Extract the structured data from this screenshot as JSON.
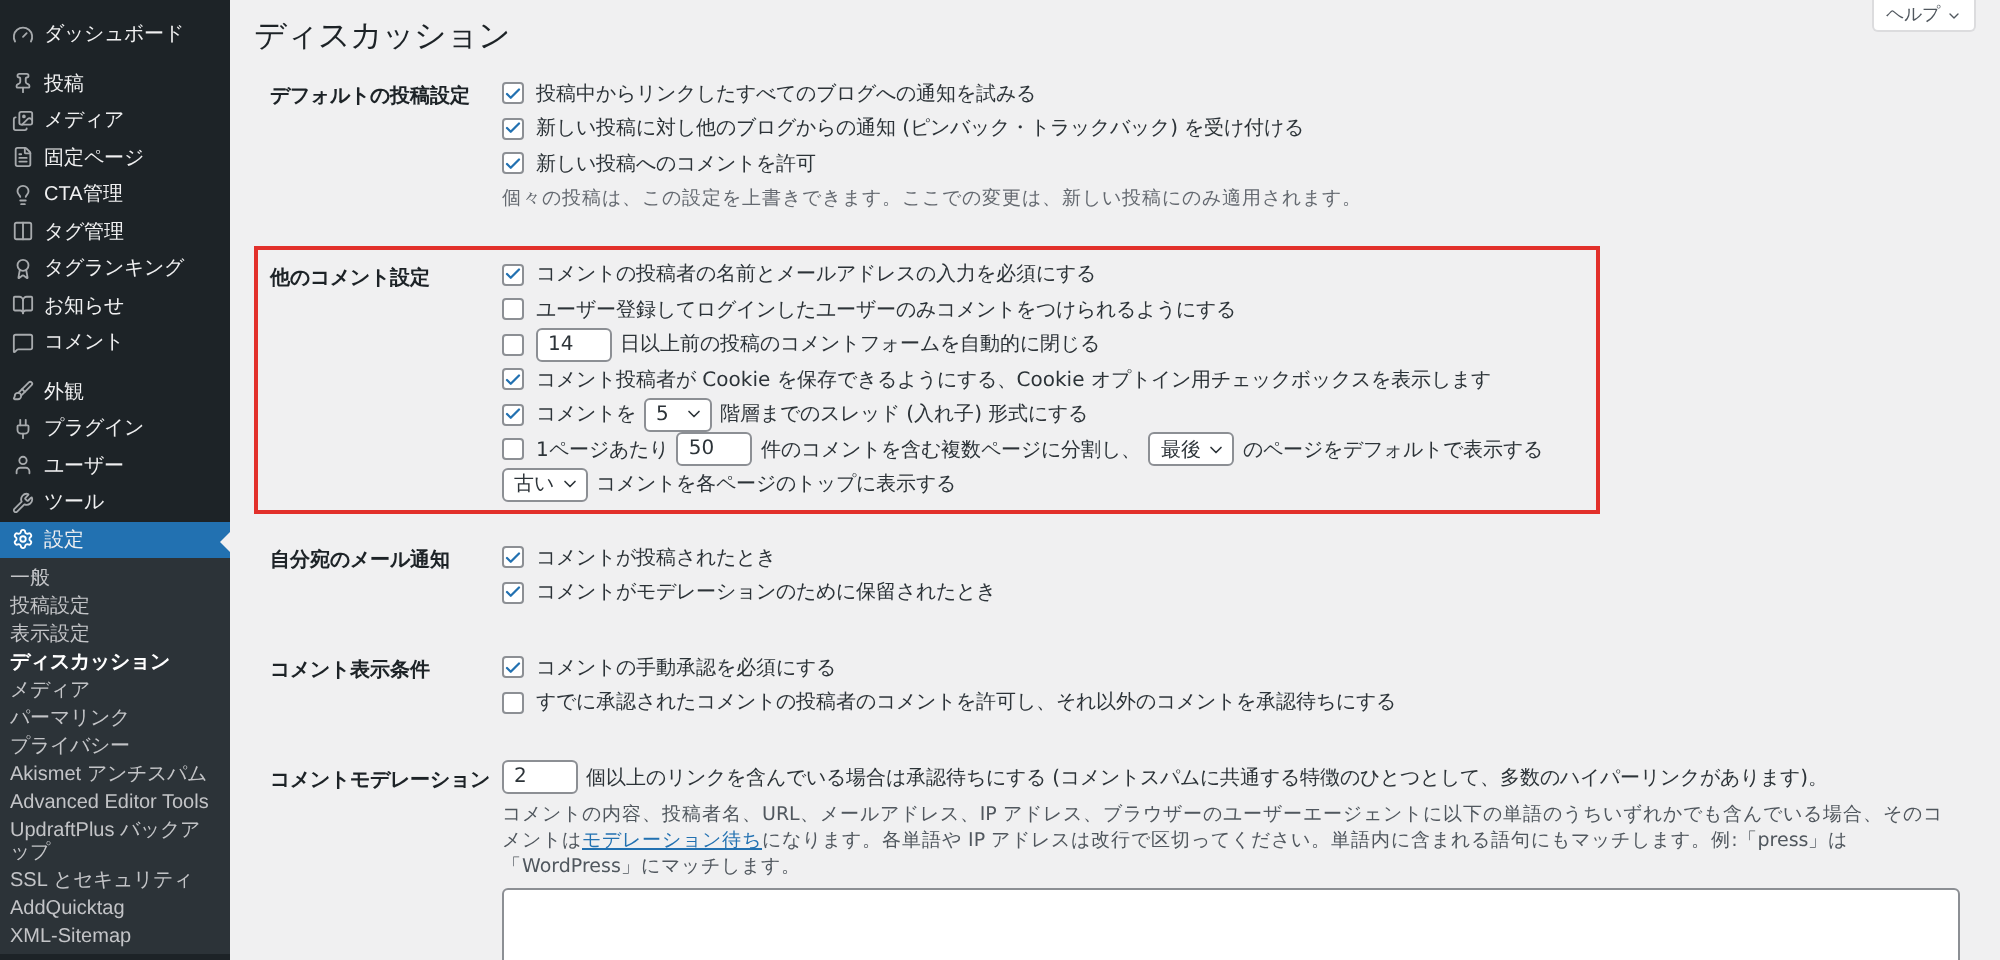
{
  "sidebar": {
    "groups": [
      [
        {
          "label": "ダッシュボード",
          "current": false
        }
      ],
      [
        {
          "label": "投稿",
          "current": false
        },
        {
          "label": "メディア",
          "current": false
        },
        {
          "label": "固定ページ",
          "current": false
        },
        {
          "label": "CTA管理",
          "current": false
        },
        {
          "label": "タグ管理",
          "current": false
        },
        {
          "label": "タグランキング",
          "current": false
        },
        {
          "label": "お知らせ",
          "current": false
        },
        {
          "label": "コメント",
          "current": false
        }
      ],
      [
        {
          "label": "外観",
          "current": false
        },
        {
          "label": "プラグイン",
          "current": false
        },
        {
          "label": "ユーザー",
          "current": false
        },
        {
          "label": "ツール",
          "current": false
        },
        {
          "label": "設定",
          "current": true,
          "submenu": [
            {
              "label": "一般",
              "selected": false
            },
            {
              "label": "投稿設定",
              "selected": false
            },
            {
              "label": "表示設定",
              "selected": false
            },
            {
              "label": "ディスカッション",
              "selected": true
            },
            {
              "label": "メディア",
              "selected": false
            },
            {
              "label": "パーマリンク",
              "selected": false
            },
            {
              "label": "プライバシー",
              "selected": false
            },
            {
              "label": "Akismet アンチスパム",
              "selected": false
            },
            {
              "label": "Advanced Editor Tools",
              "selected": false
            },
            {
              "label": "UpdraftPlus バックアップ",
              "selected": false
            },
            {
              "label": "SSL とセキュリティ",
              "selected": false
            },
            {
              "label": "AddQuicktag",
              "selected": false
            },
            {
              "label": "XML-Sitemap",
              "selected": false
            }
          ]
        }
      ]
    ]
  },
  "help_button": {
    "label": "ヘルプ"
  },
  "page_title": "ディスカッション",
  "sections": [
    {
      "label": "デフォルトの投稿設定",
      "highlighted": false,
      "rows": [
        {
          "kind": "check",
          "checked": true,
          "parts": [
            {
              "kind": "text",
              "text": "投稿中からリンクしたすべてのブログへの通知を試みる"
            }
          ]
        },
        {
          "kind": "check",
          "checked": true,
          "parts": [
            {
              "kind": "text",
              "text": "新しい投稿に対し他のブログからの通知 (ピンバック・トラックバック) を受け付ける"
            }
          ]
        },
        {
          "kind": "check",
          "checked": true,
          "parts": [
            {
              "kind": "text",
              "text": "新しい投稿へのコメントを許可"
            }
          ]
        },
        {
          "kind": "note",
          "text": "個々の投稿は、この設定を上書きできます。ここでの変更は、新しい投稿にのみ適用されます。"
        }
      ]
    },
    {
      "label": "他のコメント設定",
      "highlighted": true,
      "rows": [
        {
          "kind": "check",
          "checked": true,
          "parts": [
            {
              "kind": "text",
              "text": "コメントの投稿者の名前とメールアドレスの入力を必須にする"
            }
          ]
        },
        {
          "kind": "check",
          "checked": false,
          "parts": [
            {
              "kind": "text",
              "text": "ユーザー登録してログインしたユーザーのみコメントをつけられるようにする"
            }
          ]
        },
        {
          "kind": "check",
          "checked": false,
          "parts": [
            {
              "kind": "input",
              "value": "14"
            },
            {
              "kind": "text",
              "text": "日以上前の投稿のコメントフォームを自動的に閉じる"
            }
          ]
        },
        {
          "kind": "check",
          "checked": true,
          "parts": [
            {
              "kind": "text",
              "text": "コメント投稿者が Cookie を保存できるようにする、Cookie オプトイン用チェックボックスを表示します"
            }
          ]
        },
        {
          "kind": "check",
          "checked": true,
          "parts": [
            {
              "kind": "text",
              "text": "コメントを"
            },
            {
              "kind": "select",
              "value": "5"
            },
            {
              "kind": "text",
              "text": "階層までのスレッド (入れ子) 形式にする"
            }
          ]
        },
        {
          "kind": "check",
          "checked": false,
          "parts": [
            {
              "kind": "text",
              "text": "1ページあたり"
            },
            {
              "kind": "input",
              "value": "50"
            },
            {
              "kind": "text",
              "text": "件のコメントを含む複数ページに分割し、"
            },
            {
              "kind": "select",
              "value": "最後"
            },
            {
              "kind": "text",
              "text": "のページをデフォルトで表示する"
            }
          ]
        },
        {
          "kind": "plain",
          "parts": [
            {
              "kind": "select",
              "value": "古い"
            },
            {
              "kind": "text",
              "text": "コメントを各ページのトップに表示する"
            }
          ]
        }
      ]
    },
    {
      "label": "自分宛のメール通知",
      "highlighted": false,
      "rows": [
        {
          "kind": "check",
          "checked": true,
          "parts": [
            {
              "kind": "text",
              "text": "コメントが投稿されたとき"
            }
          ]
        },
        {
          "kind": "check",
          "checked": true,
          "parts": [
            {
              "kind": "text",
              "text": "コメントがモデレーションのために保留されたとき"
            }
          ]
        }
      ]
    },
    {
      "label": "コメント表示条件",
      "highlighted": false,
      "rows": [
        {
          "kind": "check",
          "checked": true,
          "parts": [
            {
              "kind": "text",
              "text": "コメントの手動承認を必須にする"
            }
          ]
        },
        {
          "kind": "check",
          "checked": false,
          "parts": [
            {
              "kind": "text",
              "text": "すでに承認されたコメントの投稿者のコメントを許可し、それ以外のコメントを承認待ちにする"
            }
          ]
        }
      ]
    },
    {
      "label": "コメントモデレーション",
      "highlighted": false,
      "rows": [
        {
          "kind": "plain",
          "parts": [
            {
              "kind": "input",
              "value": "2"
            },
            {
              "kind": "text",
              "text": "個以上のリンクを含んでいる場合は承認待ちにする (コメントスパムに共通する特徴のひとつとして、多数のハイパーリンクがあります)。"
            }
          ]
        },
        {
          "kind": "paragraph",
          "parts": [
            {
              "kind": "text",
              "text": "コメントの内容、投稿者名、URL、メールアドレス、IP アドレス、ブラウザーのユーザーエージェントに以下の単語のうちいずれかでも含んでいる場合、そのコメントは"
            },
            {
              "kind": "link",
              "text": "モデレーション待ち"
            },
            {
              "kind": "text",
              "text": "になります。各単語や IP アドレスは改行で区切ってください。単語内に含まれる語句にもマッチします。例:「press」は「WordPress」にマッチします。"
            }
          ]
        },
        {
          "kind": "textarea"
        }
      ]
    }
  ]
}
